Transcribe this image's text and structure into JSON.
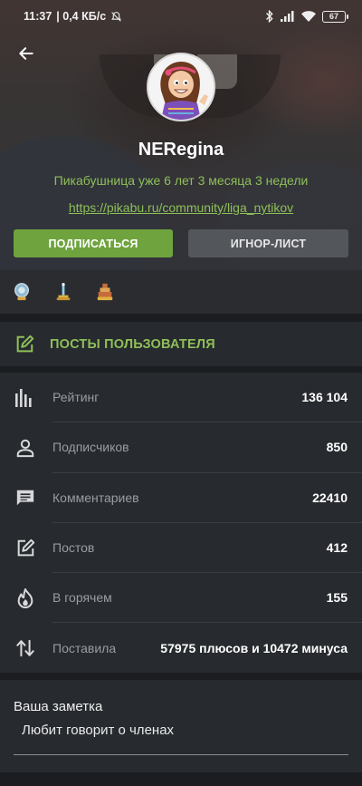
{
  "status_bar": {
    "time": "11:37",
    "speed": "| 0,4 КБ/с",
    "battery": "67"
  },
  "profile": {
    "username": "NERegina",
    "tenure": "Пикабушница уже 6 лет 3 месяца 3 недели",
    "link": "https://pikabu.ru/community/liga_nytikov",
    "subscribe_label": "ПОДПИСАТЬСЯ",
    "ignore_label": "ИГНОР-ЛИСТ"
  },
  "awards": [
    {
      "icon": "medal-award-icon",
      "color": "#7fb3d5"
    },
    {
      "icon": "trophy-award-icon",
      "color": "#e0b040"
    },
    {
      "icon": "cake-award-icon",
      "color": "#d08a3a"
    }
  ],
  "posts_link": {
    "label": "ПОСТЫ ПОЛЬЗОВАТЕЛЯ",
    "icon": "edit-icon"
  },
  "stats": [
    {
      "icon": "rating-icon",
      "label": "Рейтинг",
      "value": "136 104"
    },
    {
      "icon": "user-icon",
      "label": "Подписчиков",
      "value": "850"
    },
    {
      "icon": "comment-icon",
      "label": "Комментариев",
      "value": "22410"
    },
    {
      "icon": "edit-icon",
      "label": "Постов",
      "value": "412"
    },
    {
      "icon": "fire-icon",
      "label": "В горячем",
      "value": "155"
    },
    {
      "icon": "sort-arrows-icon",
      "label": "Поставила",
      "value": "57975 плюсов и 10472 минуса"
    }
  ],
  "note": {
    "title": "Ваша заметка",
    "text": "Любит говорит  о членах"
  },
  "colors": {
    "accent_green": "#8fbf59",
    "subscribe_bg": "#6fa33e",
    "ignore_bg": "#53565b",
    "panel_bg": "#272a2e",
    "page_bg": "#1b1d20"
  }
}
